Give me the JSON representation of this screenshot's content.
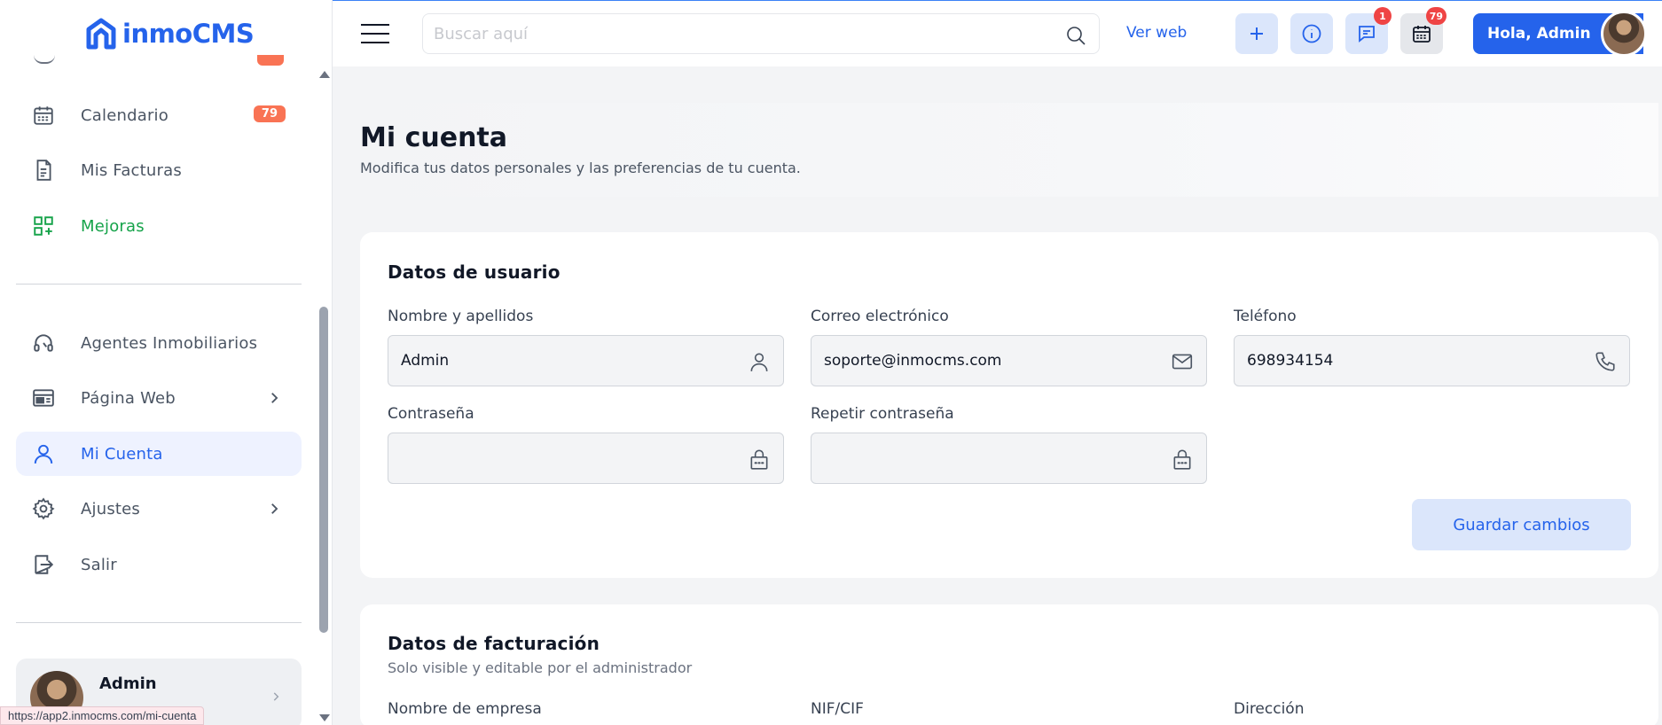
{
  "brand": {
    "name": "inmoCMS",
    "color": "#2563eb"
  },
  "sidebar": {
    "items": [
      {
        "label": "Calendario",
        "icon": "calendar-icon",
        "badge": "79"
      },
      {
        "label": "Mis Facturas",
        "icon": "invoice-icon"
      },
      {
        "label": "Mejoras",
        "icon": "grid-plus-icon",
        "color": "#16a34a"
      },
      {
        "label": "Agentes Inmobiliarios",
        "icon": "headset-icon"
      },
      {
        "label": "Página Web",
        "icon": "browser-icon"
      },
      {
        "label": "Mi Cuenta",
        "icon": "user-icon",
        "active": true
      },
      {
        "label": "Ajustes",
        "icon": "gear-icon"
      },
      {
        "label": "Salir",
        "icon": "logout-icon"
      }
    ],
    "user": {
      "name": "Admin"
    }
  },
  "status_url": "https://app2.inmocms.com/mi-cuenta",
  "topbar": {
    "search_placeholder": "Buscar aquí",
    "ver_web": "Ver web",
    "messages_badge": "1",
    "calendar_badge": "79",
    "greeting": "Hola, Admin"
  },
  "page": {
    "title": "Mi cuenta",
    "subtitle": "Modifica tus datos personales y las preferencias de tu cuenta."
  },
  "user_data": {
    "title": "Datos de usuario",
    "name_label": "Nombre y apellidos",
    "name_value": "Admin",
    "email_label": "Correo electrónico",
    "email_value": "soporte@inmocms.com",
    "phone_label": "Teléfono",
    "phone_value": "698934154",
    "password_label": "Contraseña",
    "password_value": "",
    "repeat_label": "Repetir contraseña",
    "repeat_value": "",
    "save_label": "Guardar cambios"
  },
  "billing": {
    "title": "Datos de facturación",
    "subtitle": "Solo visible y editable por el administrador",
    "company_label": "Nombre de empresa",
    "nif_label": "NIF/CIF",
    "address_label": "Dirección"
  },
  "colors": {
    "accent": "#2563eb",
    "badge": "#f97354",
    "danger": "#ef4444"
  }
}
